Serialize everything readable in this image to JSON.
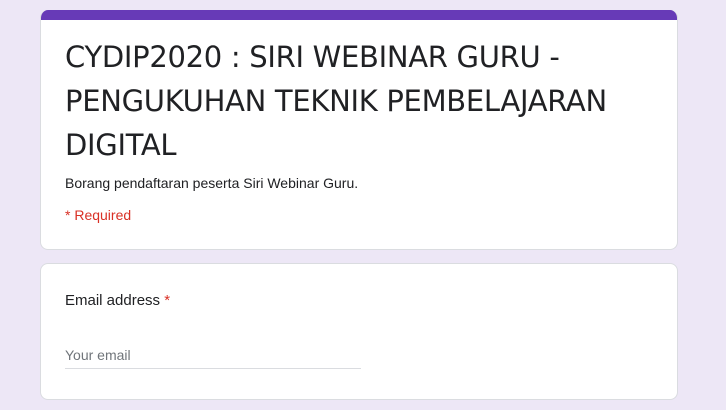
{
  "form": {
    "title": "CYDIP2020 : SIRI WEBINAR GURU - PENGUKUHAN TEKNIK PEMBELAJARAN DIGITAL",
    "description": "Borang pendaftaran peserta Siri Webinar Guru.",
    "required_note": "* Required"
  },
  "questions": [
    {
      "label": "Email address",
      "required_mark": "*",
      "placeholder": "Your email",
      "value": ""
    }
  ],
  "colors": {
    "accent": "#673ab7",
    "background": "#ede7f6",
    "required": "#d93025"
  }
}
